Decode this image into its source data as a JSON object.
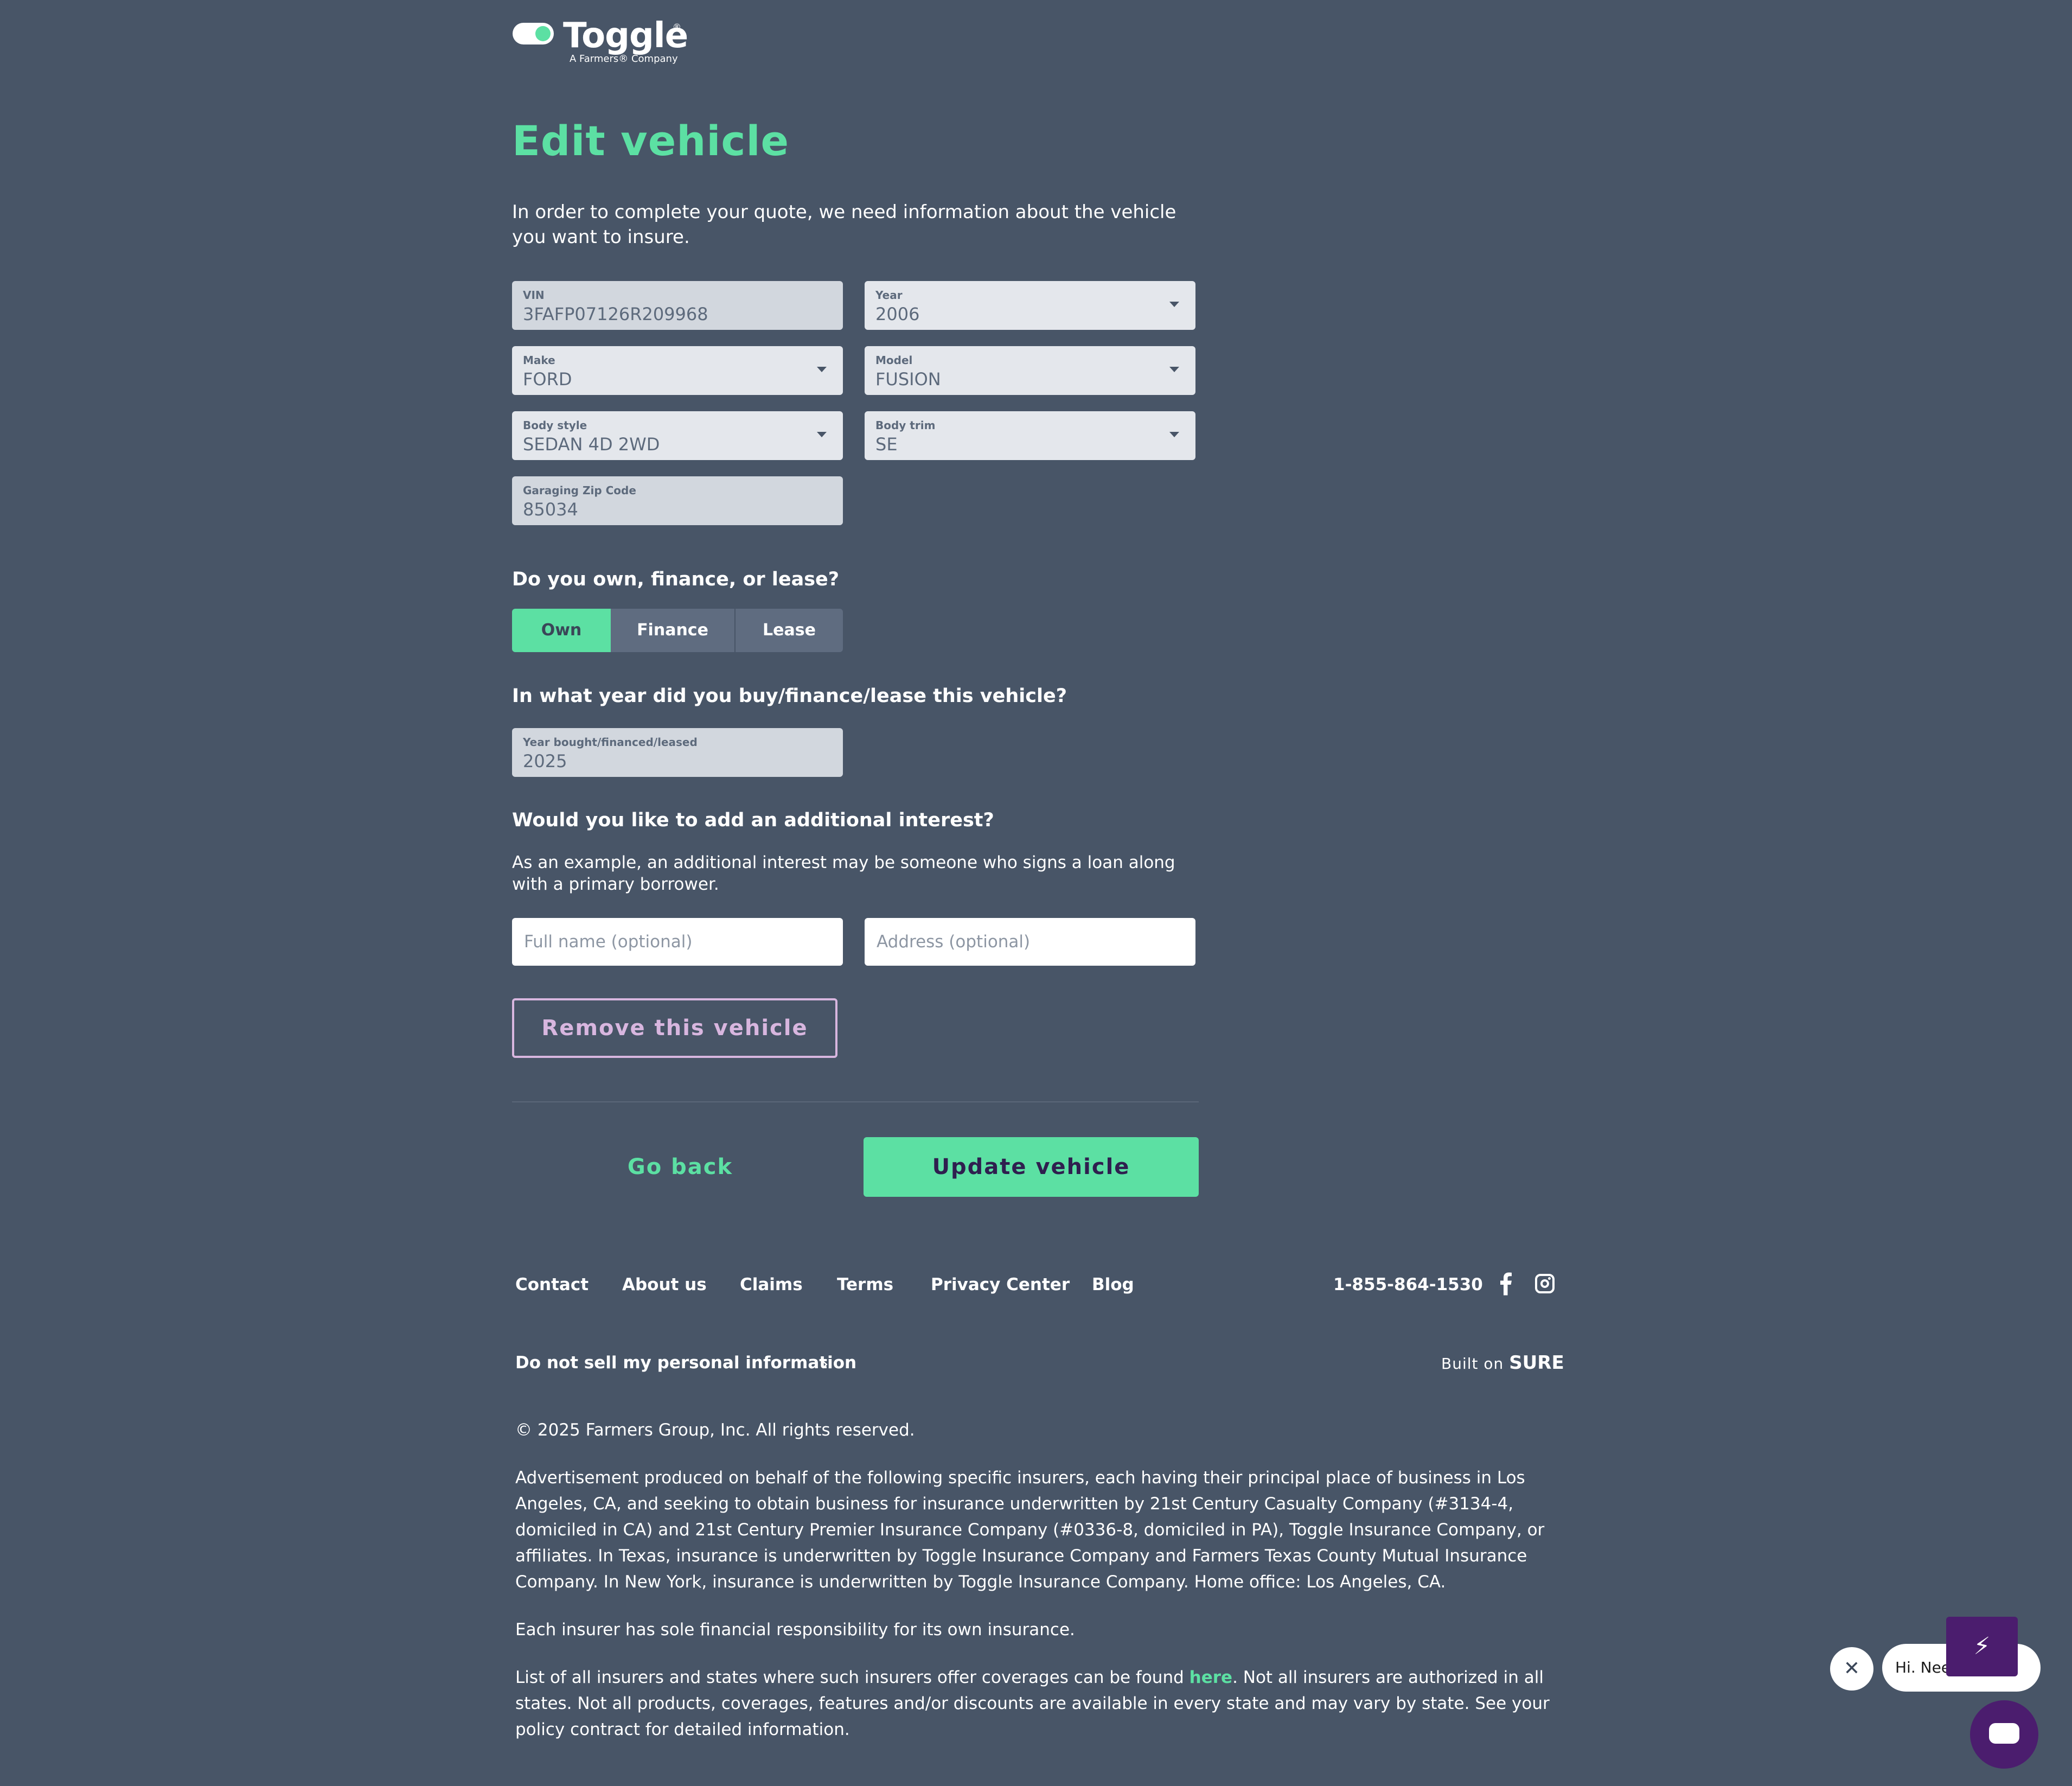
{
  "brand": {
    "name": "Toggle",
    "registered": "®",
    "tagline": "A Farmers® Company"
  },
  "page": {
    "title": "Edit vehicle",
    "intro": "In order to complete your quote, we need information about the vehicle you want to insure."
  },
  "vehicle": {
    "vin": {
      "label": "VIN",
      "value": "3FAFP07126R209968"
    },
    "year": {
      "label": "Year",
      "value": "2006"
    },
    "make": {
      "label": "Make",
      "value": "FORD"
    },
    "model": {
      "label": "Model",
      "value": "FUSION"
    },
    "body_style": {
      "label": "Body style",
      "value": "SEDAN 4D 2WD"
    },
    "body_trim": {
      "label": "Body trim",
      "value": "SE"
    },
    "zip": {
      "label": "Garaging Zip Code",
      "value": "85034"
    }
  },
  "ownership": {
    "question": "Do you own, finance, or lease?",
    "options": [
      "Own",
      "Finance",
      "Lease"
    ],
    "selected": "Own"
  },
  "year_bought": {
    "question": "In what year did you buy/finance/lease this vehicle?",
    "label": "Year bought/financed/leased",
    "value": "2025"
  },
  "additional_interest": {
    "question": "Would you like to add an additional interest?",
    "description": "As an example, an additional interest may be someone who signs a loan along with a primary borrower.",
    "name_placeholder": "Full name (optional)",
    "address_placeholder": "Address (optional)"
  },
  "actions": {
    "remove": "Remove this vehicle",
    "go_back": "Go back",
    "update": "Update vehicle"
  },
  "footer": {
    "links": [
      "Contact",
      "About us",
      "Claims",
      "Terms",
      "Privacy Center",
      "Blog"
    ],
    "phone": "1-855-864-1530",
    "do_not_sell": "Do not sell my personal information",
    "built_on_prefix": "Built on",
    "built_on_brand": "SURE",
    "copyright": "© 2025 Farmers Group, Inc. All rights reserved.",
    "legal_1": "Advertisement produced on behalf of the following specific insurers, each having their principal place of business in Los Angeles, CA, and seeking to obtain business for insurance underwritten by 21st Century Casualty Company (#3134-4, domiciled in CA) and 21st Century Premier Insurance Company (#0336-8, domiciled in PA), Toggle Insurance Company, or affiliates. In Texas, insurance is underwritten by Toggle Insurance Company and Farmers Texas County Mutual Insurance Company. In New York, insurance is underwritten by Toggle Insurance Company. Home office: Los Angeles, CA.",
    "legal_2": "Each insurer has sole financial responsibility for its own insurance.",
    "legal_3_pre": "List of all insurers and states where such insurers offer coverages can be found ",
    "legal_3_link": "here",
    "legal_3_post": ". Not all insurers are authorized in all states. Not all products, coverages, features and/or discounts are available in every state and may vary by state. See your policy contract for detailed information."
  },
  "chat": {
    "bubble_text": "Hi. Need help?",
    "close_glyph": "✕",
    "bolt_glyph": "⚡"
  },
  "colors": {
    "background": "#485567",
    "accent_green": "#5ce0a3",
    "purple": "#4b1d6e",
    "remove_border": "#d8b6df"
  }
}
